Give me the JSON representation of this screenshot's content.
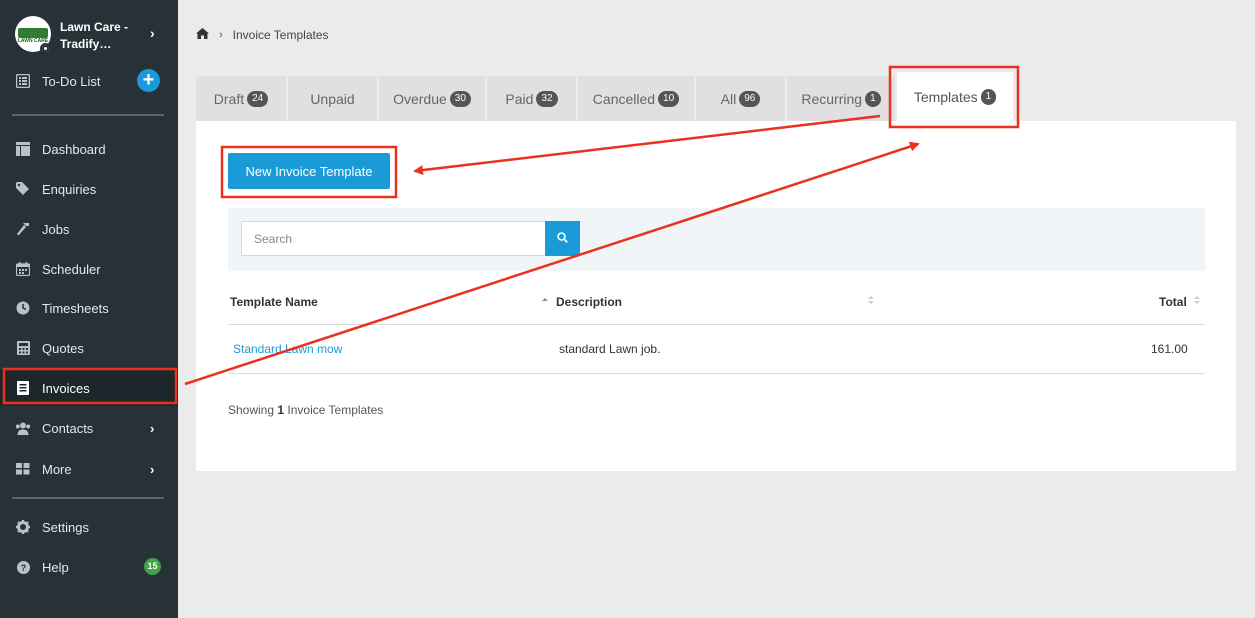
{
  "org": {
    "name_line1": "Lawn Care -",
    "name_line2": "Tradify…",
    "logo_text": "LAWN CARE"
  },
  "sidebar": {
    "todo_label": "To-Do List",
    "items": [
      {
        "label": "Dashboard",
        "icon": "dashboard-icon"
      },
      {
        "label": "Enquiries",
        "icon": "tag-icon"
      },
      {
        "label": "Jobs",
        "icon": "hammer-icon"
      },
      {
        "label": "Scheduler",
        "icon": "calendar-icon"
      },
      {
        "label": "Timesheets",
        "icon": "clock-icon"
      },
      {
        "label": "Quotes",
        "icon": "calculator-icon"
      },
      {
        "label": "Invoices",
        "icon": "invoice-icon",
        "active": true
      },
      {
        "label": "Contacts",
        "icon": "users-icon"
      },
      {
        "label": "More",
        "icon": "grid-icon"
      }
    ],
    "settings_label": "Settings",
    "help_label": "Help",
    "help_badge": "15"
  },
  "breadcrumb": {
    "current": "Invoice Templates"
  },
  "tabs": [
    {
      "label": "Draft",
      "count": "24"
    },
    {
      "label": "Unpaid",
      "count": ""
    },
    {
      "label": "Overdue",
      "count": "30"
    },
    {
      "label": "Paid",
      "count": "32"
    },
    {
      "label": "Cancelled",
      "count": "10"
    },
    {
      "label": "All",
      "count": "96"
    },
    {
      "label": "Recurring",
      "count": "1"
    },
    {
      "label": "Templates",
      "count": "1",
      "active": true
    }
  ],
  "main": {
    "new_button": "New Invoice Template",
    "search_placeholder": "Search",
    "columns": [
      "Template Name",
      "Description",
      "Total"
    ],
    "rows": [
      {
        "name": "Standard Lawn mow",
        "description": "standard Lawn job.",
        "total": "161.00"
      }
    ],
    "showing_prefix": "Showing",
    "showing_count": "1",
    "showing_suffix": "Invoice Templates"
  },
  "colors": {
    "accent": "#1a9bd7",
    "sidebar": "#263238",
    "annotation": "#e8321f",
    "help_badge": "#43a047"
  }
}
